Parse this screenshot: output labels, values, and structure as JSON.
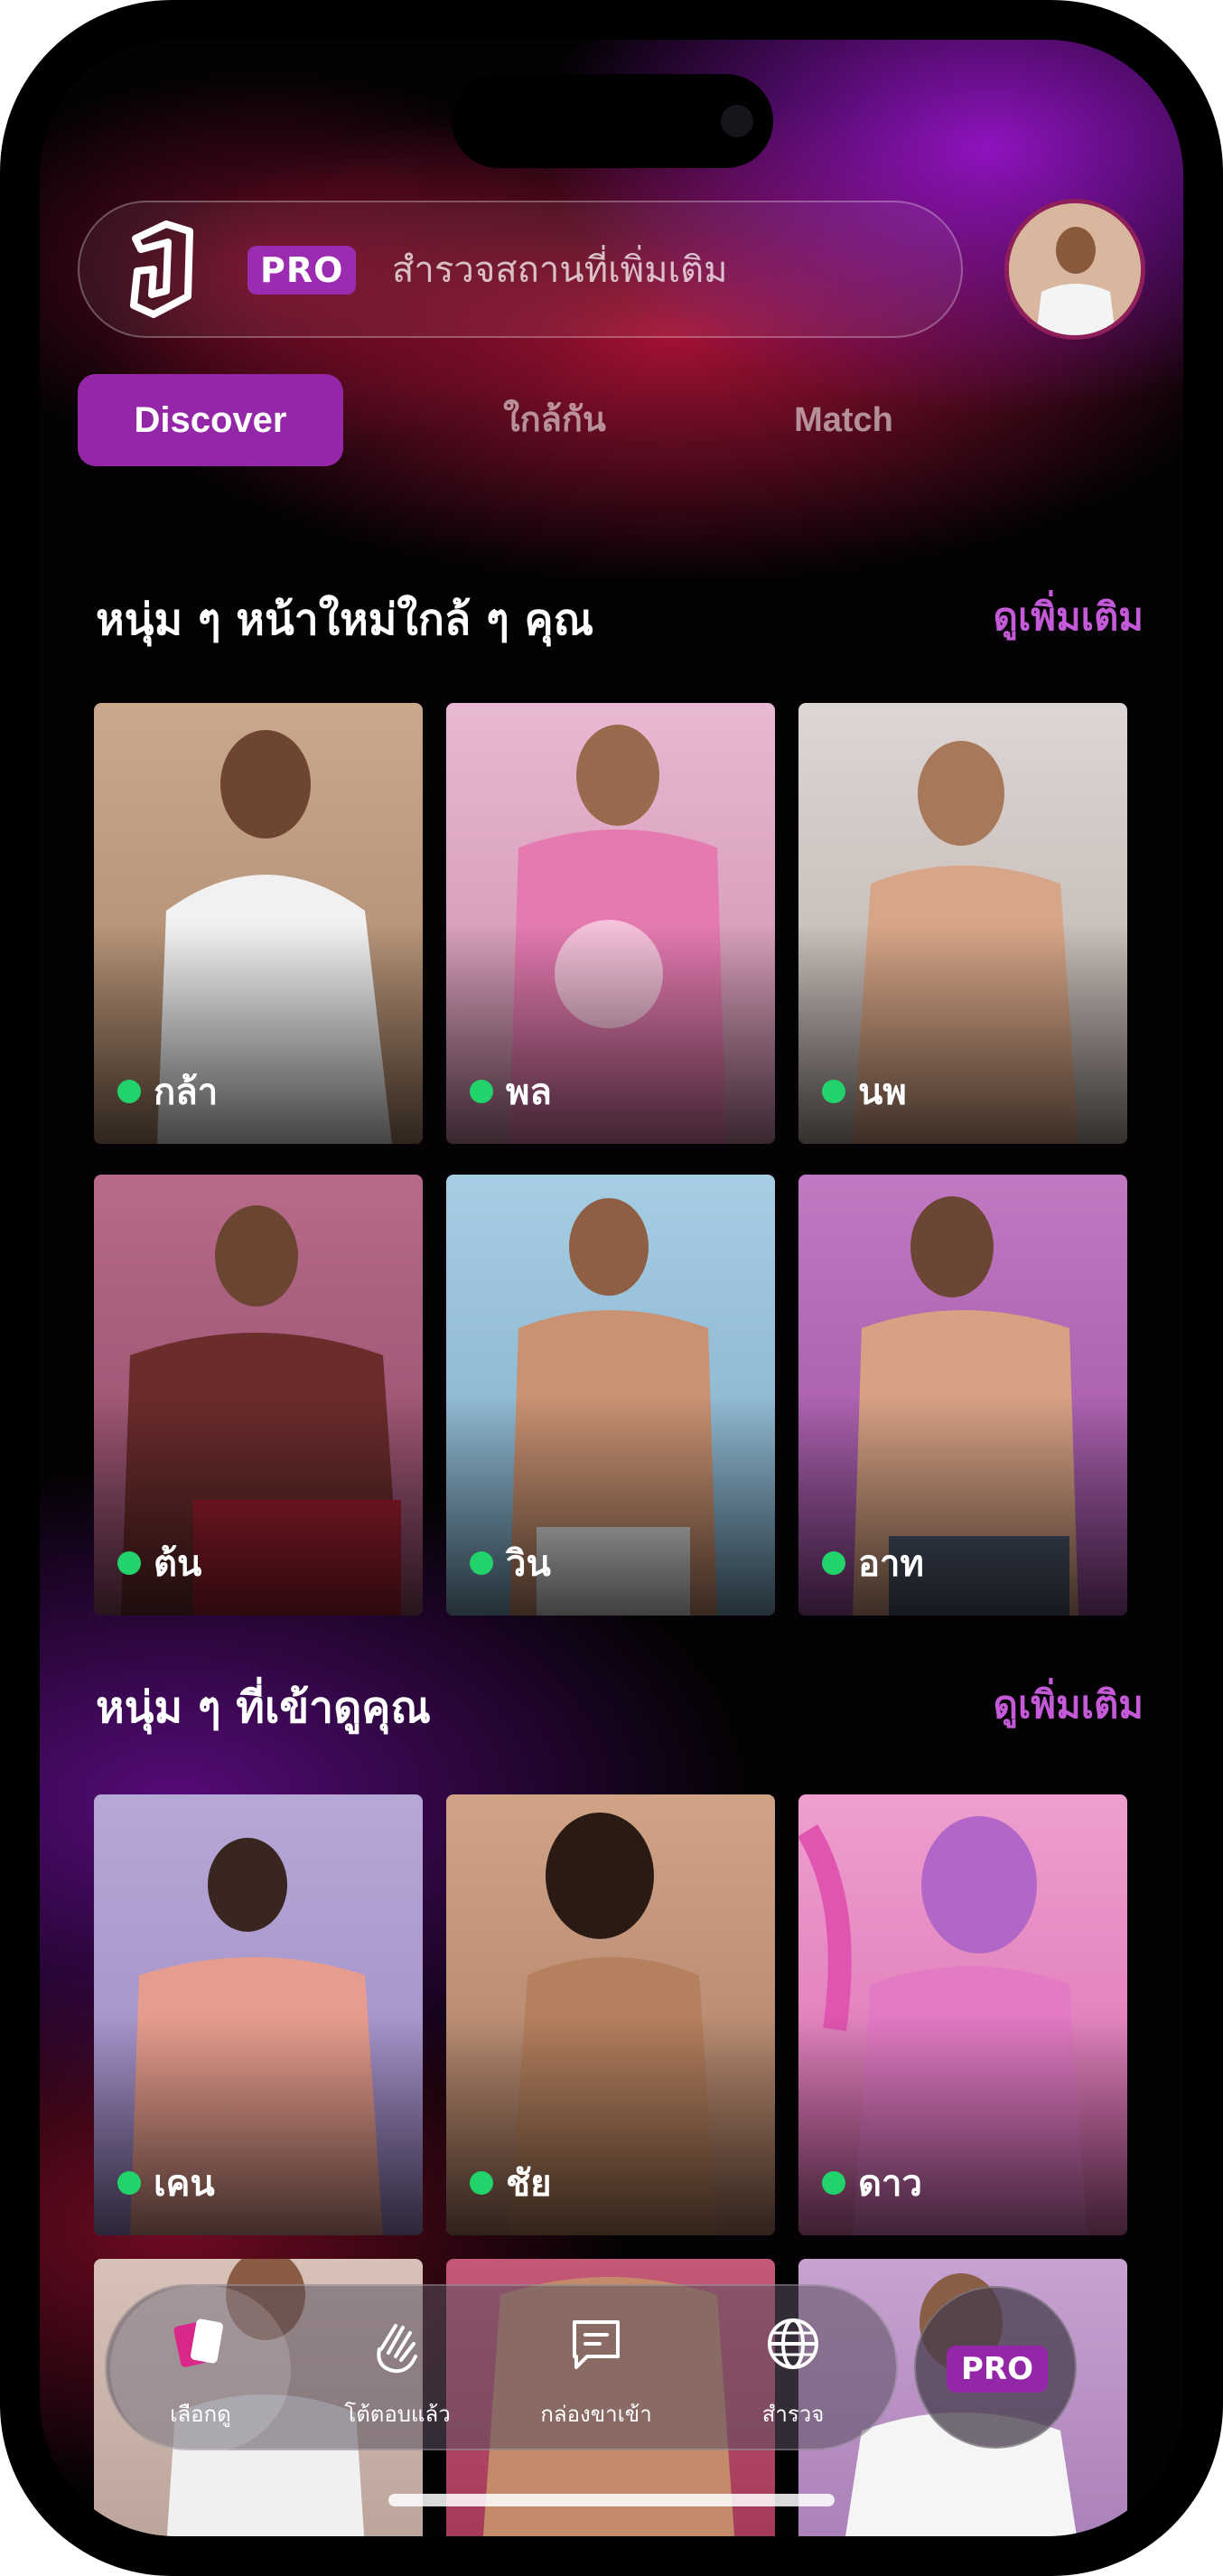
{
  "header": {
    "pro_badge": "PRO",
    "search_text": "สำรวจสถานที่เพิ่มเติม"
  },
  "tabs": [
    {
      "label": "Discover",
      "active": true
    },
    {
      "label": "ใกล้กัน",
      "active": false
    },
    {
      "label": "Match",
      "active": false
    }
  ],
  "section_new": {
    "title": "หนุ่ม ๆ หน้าใหม่ใกล้ ๆ คุณ",
    "more": "ดูเพิ่มเติม",
    "profiles": [
      {
        "name": "กล้า",
        "online": true
      },
      {
        "name": "พล",
        "online": true
      },
      {
        "name": "นพ",
        "online": true
      },
      {
        "name": "ต้น",
        "online": true
      },
      {
        "name": "วิน",
        "online": true
      },
      {
        "name": "อาท",
        "online": true
      }
    ]
  },
  "section_viewed": {
    "title": "หนุ่ม ๆ ที่เข้าดูคุณ",
    "more": "ดูเพิ่มเติม",
    "profiles": [
      {
        "name": "เคน",
        "online": true
      },
      {
        "name": "ชัย",
        "online": true
      },
      {
        "name": "ดาว",
        "online": true
      }
    ]
  },
  "bottom_nav": [
    {
      "label": "เลือกดู",
      "icon": "cards-icon",
      "active": true
    },
    {
      "label": "โต้ตอบแล้ว",
      "icon": "wave-hand-icon",
      "active": false
    },
    {
      "label": "กล่องขาเข้า",
      "icon": "chat-icon",
      "active": false
    },
    {
      "label": "สำรวจ",
      "icon": "globe-icon",
      "active": false
    }
  ],
  "pro_button": "PRO",
  "colors": {
    "accent": "#9427a8",
    "link": "#c45ad8",
    "online": "#22d36b"
  }
}
